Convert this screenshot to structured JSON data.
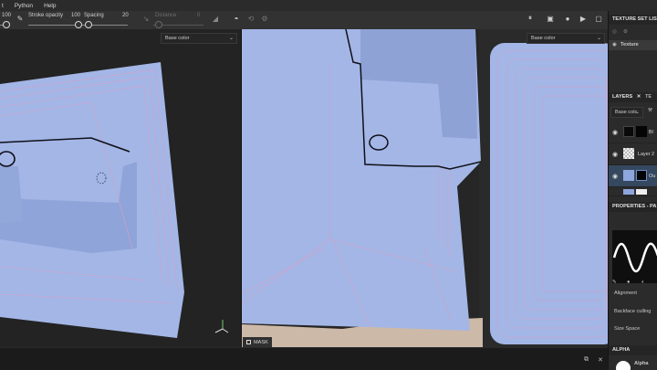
{
  "menu": {
    "items": [
      "t",
      "Python",
      "Help"
    ]
  },
  "toolbar": {
    "size_value": "100",
    "stroke_opacity_label": "Stroke opacity",
    "stroke_opacity_value": "100",
    "spacing_label": "Spacing",
    "spacing_value": "20",
    "distance_label": "Distance",
    "distance_value": "0"
  },
  "viewport_left": {
    "channel_select": "Base color"
  },
  "viewport_right": {
    "channel_select": "Base color",
    "mask_label": "MASK"
  },
  "right_panel": {
    "texture_set_list_title": "TEXTURE SET LIS",
    "texture_set_item": "Texture",
    "layers_tab": "LAYERS",
    "textures_tab": "TE",
    "channel_select": "Base colc",
    "layers": [
      {
        "name": "Bl",
        "selected": false
      },
      {
        "name": "Layer 2",
        "selected": false
      },
      {
        "name": "Ou",
        "selected": true
      }
    ],
    "properties_title": "PROPERTIES - PA",
    "prop_alignment": "Alignment",
    "prop_backface": "Backface culling",
    "prop_size_space": "Size Space",
    "alpha_title": "ALPHA",
    "alpha_label": "Alpha"
  },
  "colors": {
    "mesh_fill": "#a3b6e6",
    "mesh_shadow": "#7f96cf",
    "wire": "#d6a0c6",
    "stroke": "#101018",
    "selected_layer": "#35485f"
  }
}
